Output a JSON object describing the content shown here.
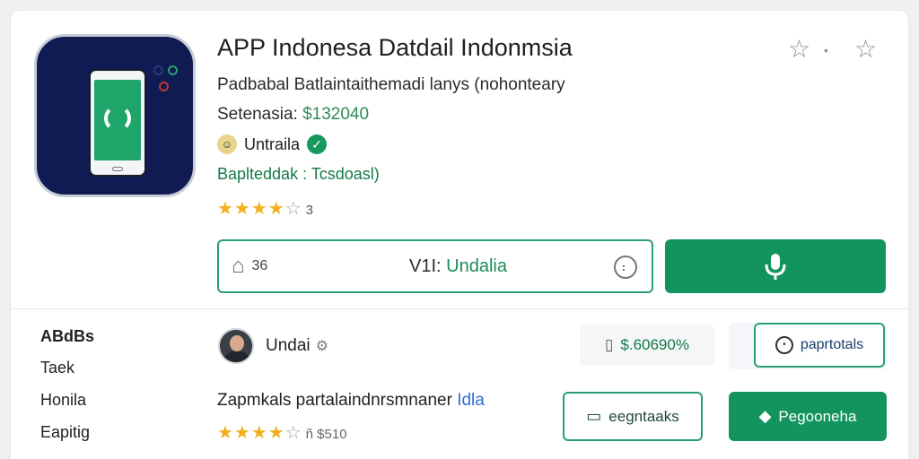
{
  "app": {
    "title": "APP Indonesa Datdail Indonmsia",
    "subtitle": "Padbabal Batlaintaithemadi lanys (nohonteary",
    "price_label": "Setenasia:",
    "price_value": "$132040",
    "developer": "Untraila",
    "category": "Baplteddak : Tcsdoasl)",
    "stars": "★★★★",
    "stars_empty": "☆",
    "rating_count": "3",
    "version_prefix": "V1I:",
    "version_value": "Undalia",
    "home_count": "36"
  },
  "sidebar": {
    "items": [
      "ABdBs",
      "Taek",
      "Honila",
      "Eapitig"
    ]
  },
  "review": {
    "name": "Undai",
    "text": "Zapmkals partalaindnrsmnaner",
    "link": "Idla",
    "stars": "★★★★",
    "stars_empty": "☆",
    "extra": "ñ $510"
  },
  "actions": {
    "price_button": "$.60690%",
    "paper_button": "paprtotals",
    "message_button": "eegntaaks",
    "go_button": "Pegooneha"
  },
  "colors": {
    "accent": "#13945e",
    "outline": "#2aa070",
    "icon_bg": "#0f1b52",
    "star": "#f2b01e"
  },
  "icons": [
    "star-outline-icon",
    "home-icon",
    "smile-icon",
    "mic-icon",
    "verified-icon",
    "gear-icon",
    "tag-icon",
    "message-icon",
    "tag-fill-icon"
  ]
}
